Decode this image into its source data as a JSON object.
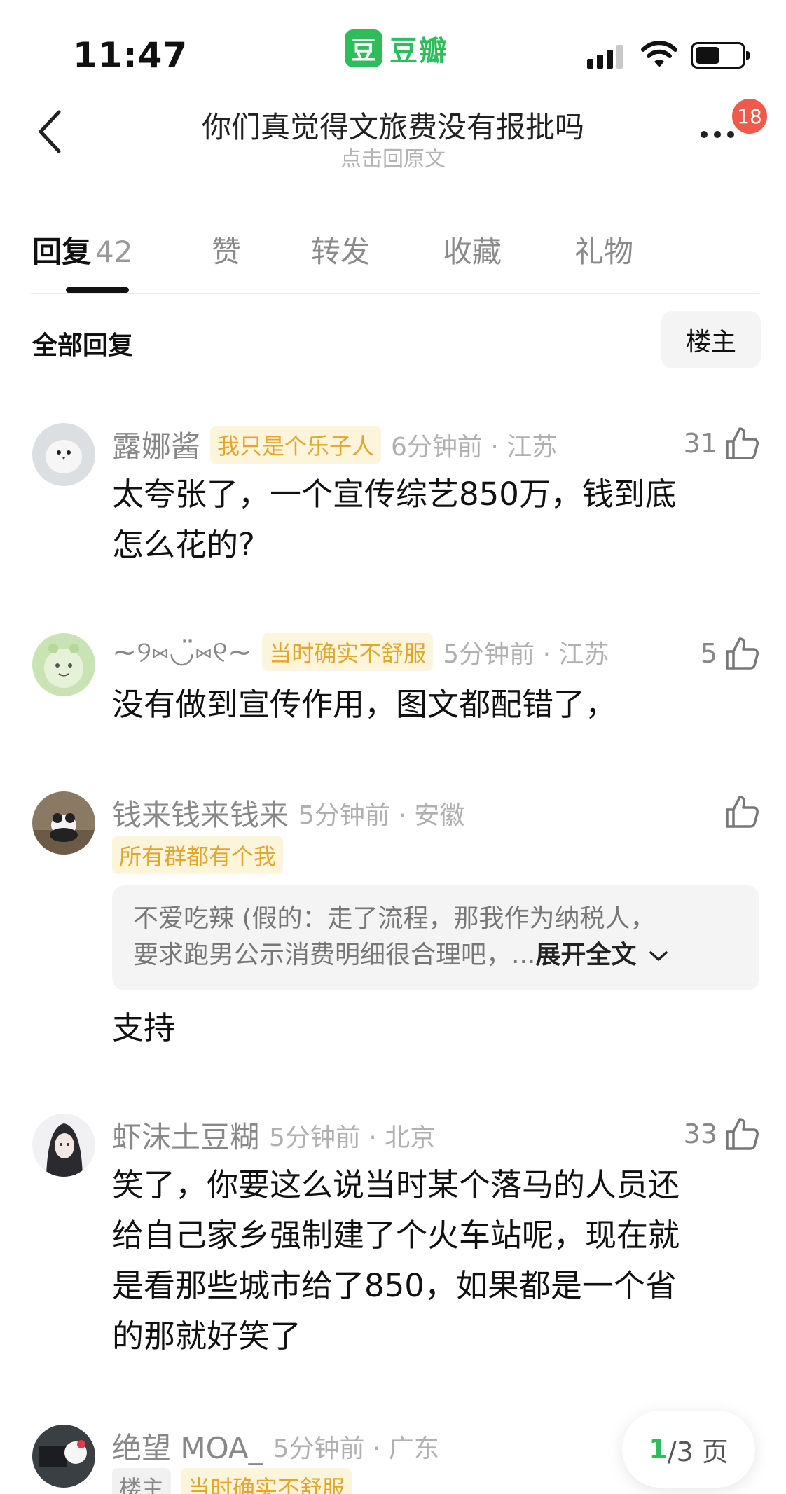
{
  "status_bar": {
    "time": "11:47",
    "app_logo_char": "豆",
    "app_name": "豆瓣",
    "icons": [
      "signal-icon",
      "wifi-icon",
      "battery-icon"
    ]
  },
  "header": {
    "title": "你们真觉得文旅费没有报批吗",
    "subtitle": "点击回原文",
    "notification_count": "18"
  },
  "tabs": [
    {
      "label": "回复",
      "count": "42",
      "active": true
    },
    {
      "label": "赞"
    },
    {
      "label": "转发"
    },
    {
      "label": "收藏"
    },
    {
      "label": "礼物"
    }
  ],
  "section": {
    "title": "全部回复",
    "op_filter": "楼主"
  },
  "comments": [
    {
      "username": "露娜酱",
      "badge": "我只是个乐子人",
      "time_location": "6分钟前 · 江苏",
      "likes": "31",
      "lines": [
        "太夸张了，一个宣传综艺850万，钱到底",
        "怎么花的?"
      ]
    },
    {
      "username": "~୨⑅◡̈⑅୧~",
      "badge": "当时确实不舒服",
      "time_location": "5分钟前 · 江苏",
      "likes": "5",
      "lines": [
        "没有做到宣传作用，图文都配错了，"
      ]
    },
    {
      "username": "钱来钱来钱来",
      "badge": "所有群都有个我",
      "time_location": "5分钟前 · 安徽",
      "likes": "",
      "quote_lines": [
        "不爱吃辣 (假的：走了流程，那我作为纳税人，",
        "要求跑男公示消费明细很合理吧，..."
      ],
      "quote_expand": "展开全文",
      "lines": [
        "支持"
      ]
    },
    {
      "username": "虾沫土豆糊",
      "badge": "",
      "time_location": "5分钟前 · 北京",
      "likes": "33",
      "lines": [
        "笑了，你要这么说当时某个落马的人员还",
        "给自己家乡强制建了个火车站呢，现在就",
        "是看那些城市给了850，如果都是一个省",
        "的那就好笑了"
      ]
    },
    {
      "username": "绝望 MOA_",
      "time_location": "5分钟前 · 广东",
      "tags": [
        "楼主",
        "当时确实不舒服"
      ]
    }
  ],
  "pagination": {
    "current": "1",
    "rest": "/3 页"
  },
  "colors": {
    "brand_green": "#2dbd5a",
    "badge_yellow": "#e3a629",
    "badge_bg": "#fdf4dc",
    "notif_red": "#f05a4b"
  }
}
